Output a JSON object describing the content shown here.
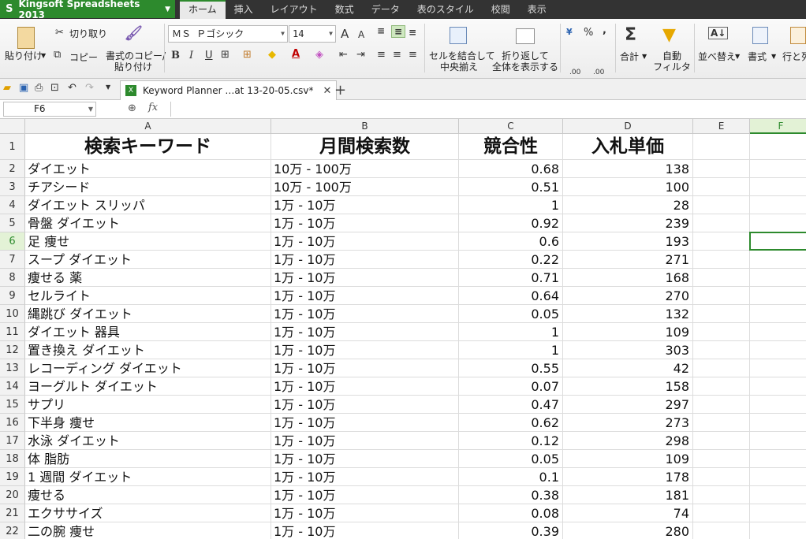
{
  "app": {
    "title": "Kingsoft Spreadsheets 2013",
    "logo": "S",
    "menu_tabs": [
      "ホーム",
      "挿入",
      "レイアウト",
      "数式",
      "データ",
      "表のスタイル",
      "校閲",
      "表示"
    ],
    "active_tab": 0
  },
  "ribbon": {
    "paste": "貼り付け",
    "cut": "切り取り",
    "copy": "コピー",
    "format_painter_line1": "書式のコピー/",
    "format_painter_line2": "貼り付け",
    "font_name": "ＭＳ Ｐゴシック",
    "font_size": "14",
    "bold": "B",
    "italic": "I",
    "underline": "U",
    "font_grow": "A",
    "font_shrink": "A",
    "merge_line1": "セルを結合して",
    "merge_line2": "中央揃え",
    "wrap_line1": "折り返して",
    "wrap_line2": "全体を表示する",
    "percent": "%",
    "comma": ",",
    "dec_inc": ".00",
    "dec_dec": ".00",
    "sum": "合計",
    "autofilter_line1": "自動",
    "autofilter_line2": "フィルタ",
    "sort": "並べ替え",
    "format": "書式",
    "rowcol": "行と列"
  },
  "document": {
    "tab_title": "Keyword Planner …at 13-20-05.csv*"
  },
  "formula_bar": {
    "name_box": "F6",
    "fx": "fx",
    "content": ""
  },
  "colors": {
    "accent": "#2d8a2d",
    "titlebar": "#333333"
  },
  "sheet": {
    "columns": [
      "A",
      "B",
      "C",
      "D",
      "E",
      "F"
    ],
    "selected_column": "F",
    "selected_row": 6,
    "header": [
      "検索キーワード",
      "月間検索数",
      "競合性",
      "入札単価"
    ],
    "rows": [
      {
        "n": "1"
      },
      {
        "n": "2",
        "a": "ダイエット",
        "b": "10万 - 100万",
        "c": "0.68",
        "d": "138"
      },
      {
        "n": "3",
        "a": "チアシード",
        "b": "10万 - 100万",
        "c": "0.51",
        "d": "100"
      },
      {
        "n": "4",
        "a": "ダイエット スリッパ",
        "b": "1万 - 10万",
        "c": "1",
        "d": "28"
      },
      {
        "n": "5",
        "a": "骨盤 ダイエット",
        "b": "1万 - 10万",
        "c": "0.92",
        "d": "239"
      },
      {
        "n": "6",
        "a": "足 痩せ",
        "b": "1万 - 10万",
        "c": "0.6",
        "d": "193"
      },
      {
        "n": "7",
        "a": "スープ ダイエット",
        "b": "1万 - 10万",
        "c": "0.22",
        "d": "271"
      },
      {
        "n": "8",
        "a": "痩せる 薬",
        "b": "1万 - 10万",
        "c": "0.71",
        "d": "168"
      },
      {
        "n": "9",
        "a": "セルライト",
        "b": "1万 - 10万",
        "c": "0.64",
        "d": "270"
      },
      {
        "n": "10",
        "a": "縄跳び ダイエット",
        "b": "1万 - 10万",
        "c": "0.05",
        "d": "132"
      },
      {
        "n": "11",
        "a": "ダイエット 器具",
        "b": "1万 - 10万",
        "c": "1",
        "d": "109"
      },
      {
        "n": "12",
        "a": "置き換え ダイエット",
        "b": "1万 - 10万",
        "c": "1",
        "d": "303"
      },
      {
        "n": "13",
        "a": "レコーディング ダイエット",
        "b": "1万 - 10万",
        "c": "0.55",
        "d": "42"
      },
      {
        "n": "14",
        "a": "ヨーグルト ダイエット",
        "b": "1万 - 10万",
        "c": "0.07",
        "d": "158"
      },
      {
        "n": "15",
        "a": "サプリ",
        "b": "1万 - 10万",
        "c": "0.47",
        "d": "297"
      },
      {
        "n": "16",
        "a": "下半身 痩せ",
        "b": "1万 - 10万",
        "c": "0.62",
        "d": "273"
      },
      {
        "n": "17",
        "a": "水泳 ダイエット",
        "b": "1万 - 10万",
        "c": "0.12",
        "d": "298"
      },
      {
        "n": "18",
        "a": "体 脂肪",
        "b": "1万 - 10万",
        "c": "0.05",
        "d": "109"
      },
      {
        "n": "19",
        "a": "1 週間 ダイエット",
        "b": "1万 - 10万",
        "c": "0.1",
        "d": "178"
      },
      {
        "n": "20",
        "a": "痩せる",
        "b": "1万 - 10万",
        "c": "0.38",
        "d": "181"
      },
      {
        "n": "21",
        "a": "エクササイズ",
        "b": "1万 - 10万",
        "c": "0.08",
        "d": "74"
      },
      {
        "n": "22",
        "a": "二の腕 痩せ",
        "b": "1万 - 10万",
        "c": "0.39",
        "d": "280"
      }
    ]
  }
}
